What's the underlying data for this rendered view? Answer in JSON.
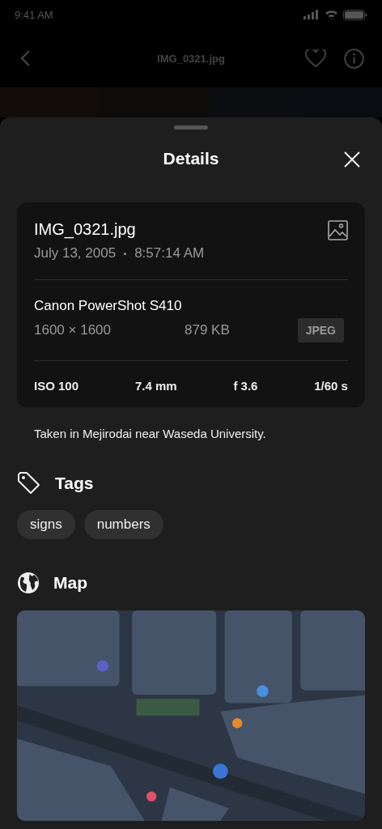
{
  "status_bar": {
    "time": "9:41 AM"
  },
  "nav_bar": {
    "title": "IMG_0321.jpg"
  },
  "sheet": {
    "title": "Details"
  },
  "file": {
    "name": "IMG_0321.jpg",
    "date": "July 13, 2005",
    "time": "8:57:14 AM"
  },
  "camera": {
    "model": "Canon PowerShot S410",
    "dimensions": "1600 × 1600",
    "size": "879 KB",
    "format": "JPEG"
  },
  "exif": [
    "ISO 100",
    "7.4 mm",
    "f 3.6",
    "1/60 s"
  ],
  "caption": "Taken in Mejirodai near Waseda University.",
  "tags": {
    "title": "Tags",
    "items": [
      "signs",
      "numbers"
    ]
  },
  "map": {
    "title": "Map",
    "kind": "picture"
  }
}
